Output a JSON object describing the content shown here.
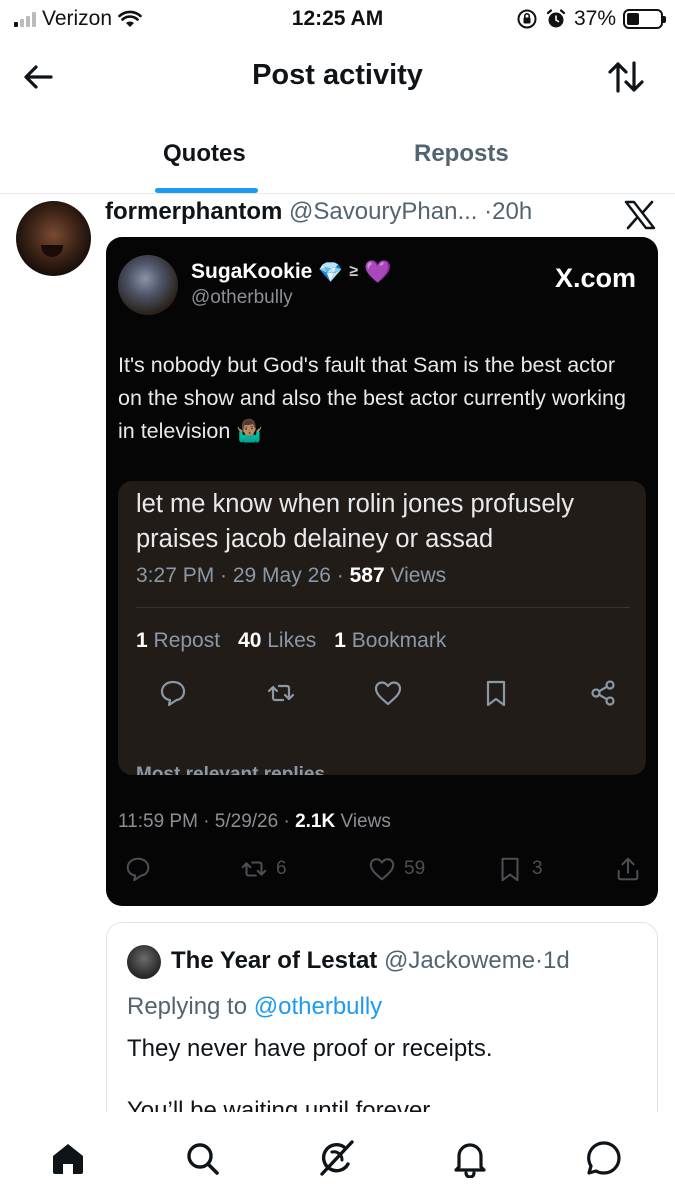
{
  "status_bar": {
    "carrier": "Verizon",
    "time": "12:25 AM",
    "battery": "37%"
  },
  "header": {
    "title": "Post activity"
  },
  "tabs": [
    {
      "label": "Quotes",
      "active": true
    },
    {
      "label": "Reposts",
      "active": false
    }
  ],
  "post": {
    "name": "formerphantom",
    "handle": "@SavouryPhan...",
    "sep": "·",
    "time": "20h",
    "card": {
      "name": "SugaKookie",
      "handle": "@otherbully",
      "brand": "X.com",
      "text": "It's nobody but God's fault that Sam is the best actor on the show and also the best actor currently working in television 🤷🏽‍♂️",
      "inner": {
        "text": "let me know when rolin jones profusely praises jacob delainey or assad",
        "time": "3:27 PM · 29 May 26 · ",
        "views_count": "587",
        "views_label": " Views",
        "reposts_count": "1",
        "reposts_label": " Repost",
        "likes_count": "40",
        "likes_label": " Likes",
        "bookmarks_count": "1",
        "bookmarks_label": " Bookmark",
        "cut_text": "Most relevant replies ⌄"
      },
      "meta_time": "11:59 PM · 5/29/26 · ",
      "views_count": "2.1K",
      "views_label": " Views",
      "reposts": "6",
      "likes": "59",
      "bookmarks": "3"
    }
  },
  "reply": {
    "name": "The Year of Lestat",
    "handle": "@Jackoweme",
    "sep": "·",
    "time": "1d",
    "replying_prefix": "Replying to ",
    "replying_to": "@otherbully",
    "text": "They never have proof or receipts.",
    "cut_text": "You’ll be waiting until forever"
  },
  "bottom_nav": [
    "home",
    "search",
    "grok",
    "notifications",
    "messages"
  ]
}
